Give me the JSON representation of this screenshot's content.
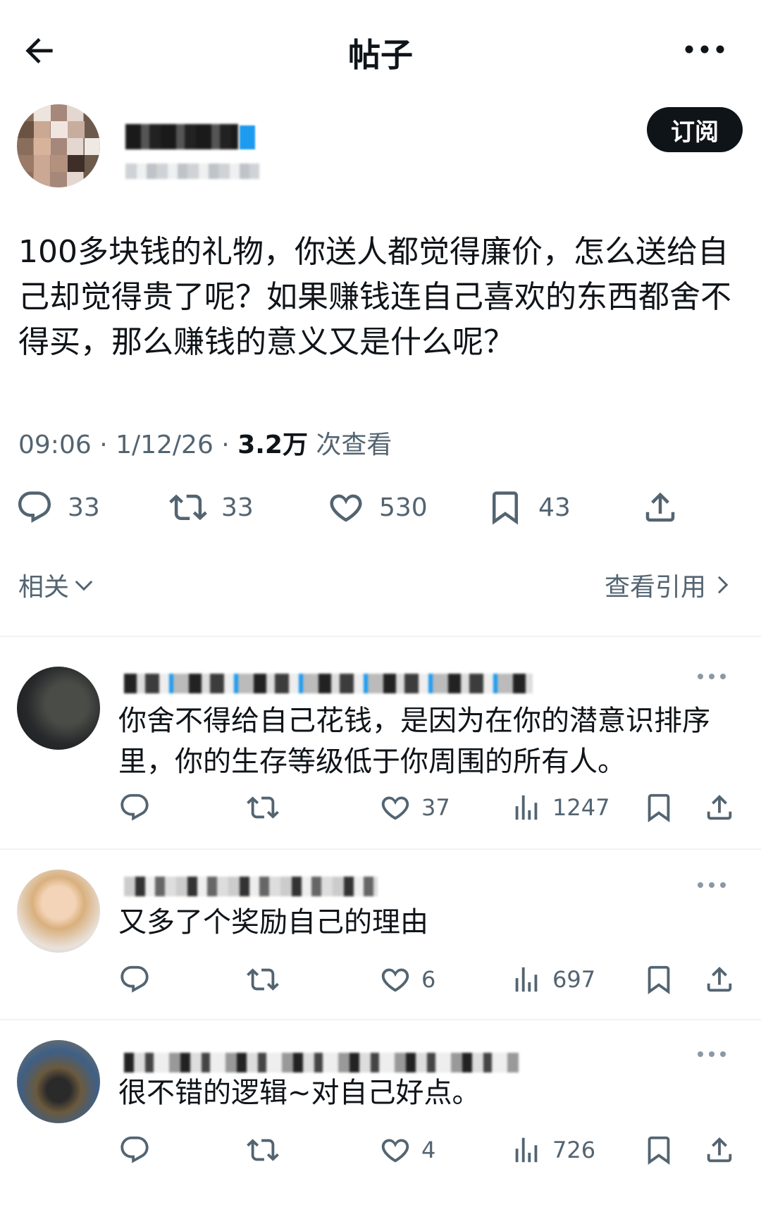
{
  "header": {
    "title": "帖子",
    "back_icon": "arrow-left-icon",
    "more_icon": "more-horizontal-icon"
  },
  "author": {
    "subscribe_label": "订阅"
  },
  "post": {
    "text": "100多块钱的礼物，你送人都觉得廉价，怎么送给自己却觉得贵了呢？如果赚钱连自己喜欢的东西都舍不得买，那么赚钱的意义又是什么呢？",
    "time": "09:06 · 1/12/26 · ",
    "views": "3.2万",
    "views_label": " 次查看",
    "replies": "33",
    "reposts": "33",
    "likes": "530",
    "bookmarks": "43"
  },
  "nav": {
    "related": "相关",
    "view_quotes": "查看引用"
  },
  "replies": [
    {
      "text": "你舍不得给自己花钱，是因为在你的潜意识排序里，你的生存等级低于你周围的所有人。",
      "likes": "37",
      "views": "1247"
    },
    {
      "text": "又多了个奖励自己的理由",
      "likes": "6",
      "views": "697"
    },
    {
      "text": "很不错的逻辑~对自己好点。",
      "likes": "4",
      "views": "726"
    }
  ],
  "colors": {
    "text": "#0f1419",
    "secondary": "#536471",
    "accent": "#1d9bf0",
    "divider": "#eff3f4"
  }
}
